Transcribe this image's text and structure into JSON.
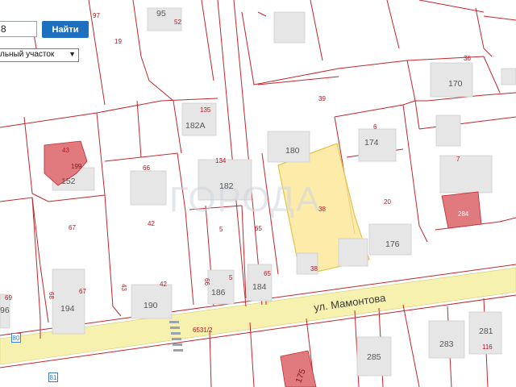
{
  "search": {
    "value": "8",
    "button_label": "Найти"
  },
  "layer_select": {
    "selected": "льный участок"
  },
  "street": {
    "name": "ул. Мамонтова"
  },
  "watermark": {
    "text": "ГОРОДА"
  },
  "road_markers": [
    "80",
    "81"
  ],
  "parcel_numbers": [
    "97",
    "19",
    "52",
    "36",
    "39",
    "135",
    "6",
    "43",
    "66",
    "134",
    "7",
    "42",
    "67",
    "5",
    "65",
    "20",
    "38",
    "284",
    "69",
    "68",
    "67",
    "43",
    "66",
    "5",
    "65",
    "42",
    "6531/2",
    "116"
  ],
  "building_numbers": [
    "95",
    "170",
    "182А",
    "180",
    "174",
    "199",
    "182",
    "152",
    "176",
    "194",
    "186",
    "184",
    "190",
    "96",
    "281",
    "283",
    "285",
    "175"
  ],
  "colors": {
    "parcel_border": "#c0272d",
    "road": "#f7f1b0",
    "building": "#e6e6e6",
    "highlight_building": "#e07a7e",
    "selected_parcel": "#fbe79a",
    "button": "#1f6fbf"
  }
}
